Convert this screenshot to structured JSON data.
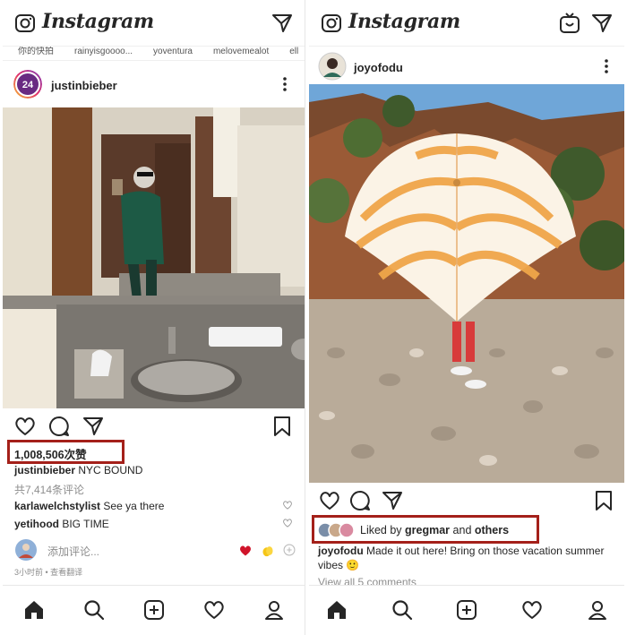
{
  "left": {
    "app_title": "Instagram",
    "stories": [
      "你的快拍",
      "rainyisgoooo...",
      "yoventura",
      "melovemealot",
      "ell"
    ],
    "post": {
      "username": "justinbieber",
      "likes": "1,008,506次赞",
      "caption_user": "justinbieber",
      "caption_text": "NYC BOUND",
      "comments_count": "共7,414条评论",
      "comments": [
        {
          "user": "karlawelchstylist",
          "text": "See ya there"
        },
        {
          "user": "yetihood",
          "text": "BIG TIME"
        }
      ],
      "add_comment_placeholder": "添加评论...",
      "quick_emojis": [
        "heart-emoji",
        "clap-emoji",
        "plus-emoji"
      ],
      "timestamp": "3小时前 • 查看翻译"
    }
  },
  "right": {
    "app_title": "Instagram",
    "post": {
      "username": "joyofodu",
      "liked_by_prefix": "Liked by ",
      "liked_by_user": "gregmar",
      "liked_by_mid": " and ",
      "liked_by_others": "others",
      "caption_user": "joyofodu",
      "caption_text": "Made it out here! Bring on those vacation summer vibes 🙂",
      "view_comments": "View all 5 comments"
    }
  },
  "nav_items": [
    "home-icon",
    "search-icon",
    "new-post-icon",
    "activity-icon",
    "profile-icon"
  ],
  "colors": {
    "highlight_box": "#a4201a",
    "text_primary": "#262626",
    "text_muted": "#8e8e8e",
    "heart_red": "#ed4956"
  }
}
